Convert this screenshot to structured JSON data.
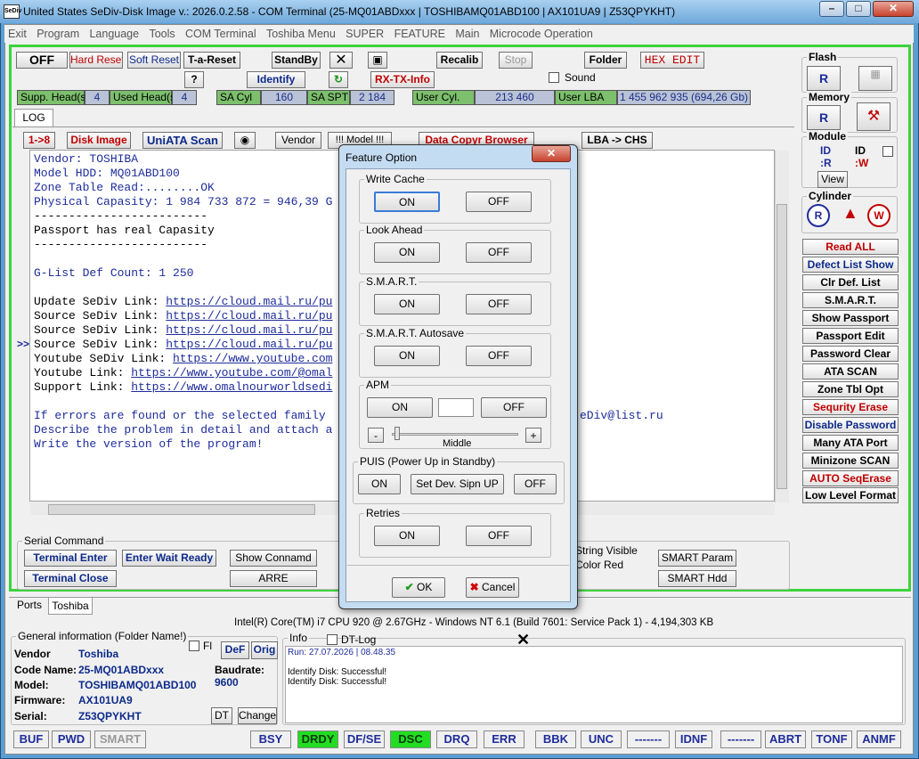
{
  "window": {
    "title": "United States  SeDiv-Disk Image v.: 2026.0.2.58 - COM Terminal  (25-MQ01ABDxxx | TOSHIBAMQ01ABD100 | AX101UA9 | Z53QPYKHT)",
    "icon_text": "SeDiv"
  },
  "menu": [
    "Exit",
    "Program",
    "Language",
    "Tools",
    "COM Terminal",
    "Toshiba Menu",
    "SUPER",
    "FEATURE",
    "Main",
    "Microcode Operation"
  ],
  "toolbar": {
    "off": "OFF",
    "hard_reset": "Hard Reset",
    "soft_reset": "Soft Reset",
    "t_a_reset": "T-a-Reset",
    "standby": "StandBy",
    "recalib": "Recalib",
    "stop": "Stop",
    "folder": "Folder",
    "hex_edit": "HEX EDIT",
    "question": "?",
    "identify": "Identify",
    "rx_tx_info": "RX-TX-Info",
    "sound": "Sound"
  },
  "fields": {
    "supp_heads_label": "Supp. Head(s)",
    "supp_heads": "4",
    "used_heads_label": "Used Head(s)",
    "used_heads": "4",
    "sa_cyl_label": "SA Cyl",
    "sa_cyl": "160",
    "sa_spt_label": "SA SPT",
    "sa_spt": "2 184",
    "user_cyl_label": "User Cyl.",
    "user_cyl": "213 460",
    "user_lba_label": "User LBA",
    "user_lba": "1 455 962 935  (694,26 Gb)"
  },
  "tabs": {
    "log": "LOG",
    "ports": "Ports",
    "toshiba": "Toshiba"
  },
  "log_toolbar": {
    "one_to_eight": "1->8",
    "disk_image": "Disk Image",
    "uniata_scan": "UniATA Scan",
    "vendor": "Vendor",
    "model": "!!! Model !!!",
    "data_copy": "Data Copyr Browser",
    "lba_chs": "LBA -> CHS"
  },
  "log": {
    "lines": [
      "Vendor: TOSHIBA",
      "Model HDD: MQ01ABD100",
      "Zone Table Read:........OK",
      "Physical Capasity: 1 984 733 872 = 946,39 G",
      "-------------------------",
      "Passport has real Capasity",
      "-------------------------",
      "",
      "G-List Def Count: 1 250",
      ""
    ],
    "links": [
      {
        "label": "Update SeDiv Link: ",
        "url": "https://cloud.mail.ru/pu"
      },
      {
        "label": "Source SeDiv Link: ",
        "url": "https://cloud.mail.ru/pu"
      },
      {
        "label": "Source SeDiv Link: ",
        "url": "https://cloud.mail.ru/pu"
      },
      {
        "label": "Source SeDiv Link: ",
        "url": "https://cloud.mail.ru/pu"
      },
      {
        "label": "Youtube SeDiv Link: ",
        "url": "https://www.youtube.com"
      },
      {
        "label": "Youtube Link: ",
        "url": "https://www.youtube.com/@omal"
      },
      {
        "label": "Support Link: ",
        "url": "https://www.omalnourworldsedi"
      }
    ],
    "footer": [
      "If errors are found or the selected family ",
      "Describe the problem in detail and attach a",
      "Write the version of the program!"
    ],
    "footer_tail": "eDiv@list.ru"
  },
  "serial": {
    "title": "Serial Command",
    "terminal_enter": "Terminal Enter",
    "enter_wait_ready": "Enter Wait Ready",
    "show_command": "Show Connamd",
    "terminal_close": "Terminal Close",
    "arre": "ARRE",
    "string_visible": "String Visible",
    "color_red": "Color Red",
    "smart_param": "SMART Param",
    "smart_hdd": "SMART Hdd"
  },
  "sidebar": {
    "flash": "Flash",
    "memory": "Memory",
    "module": "Module",
    "id": "ID",
    "view": "View",
    "cylinder": "Cylinder",
    "items": [
      {
        "label": "Read ALL",
        "style": "red"
      },
      {
        "label": "Defect List Show",
        "style": "blue"
      },
      {
        "label": "Clr Def. List",
        "style": ""
      },
      {
        "label": "S.M.A.R.T.",
        "style": ""
      },
      {
        "label": "Show Passport",
        "style": ""
      },
      {
        "label": "Passport Edit",
        "style": ""
      },
      {
        "label": "Password Clear",
        "style": ""
      },
      {
        "label": "ATA SCAN",
        "style": ""
      },
      {
        "label": "Zone Tbl Opt",
        "style": ""
      },
      {
        "label": "Sequrity Erase",
        "style": "red"
      },
      {
        "label": "Disable Password",
        "style": "blue"
      },
      {
        "label": "Many ATA Port",
        "style": ""
      },
      {
        "label": "Minizone SCAN",
        "style": ""
      },
      {
        "label": "AUTO SeqErase",
        "style": "red"
      },
      {
        "label": "Low Level Format",
        "style": ""
      }
    ]
  },
  "dialog": {
    "title": "Feature Option",
    "write_cache": "Write Cache",
    "look_ahead": "Look Ahead",
    "smart": "S.M.A.R.T.",
    "smart_autosave": "S.M.A.R.T. Autosave",
    "apm": "APM",
    "puis": "PUIS (Power Up in Standby)",
    "retries": "Retries",
    "on": "ON",
    "off": "OFF",
    "middle": "Middle",
    "minus": "-",
    "plus": "+",
    "set_dev_spin_up": "Set Dev. Sipn UP",
    "ok": "OK",
    "cancel": "Cancel"
  },
  "cpu_info": "Intel(R) Core(TM) i7 CPU 920  @ 2.67GHz - Windows NT 6.1 (Build 7601: Service Pack 1) -  4,194,303 KB",
  "general_info": {
    "title": "General information (Folder Name!)",
    "fl": "Fl",
    "def": "DeF",
    "orig": "Orig",
    "vendor_label": "Vendor",
    "vendor": "Toshiba",
    "code_label": "Code Name:",
    "code": "25-MQ01ABDxxx",
    "model_label": "Model:",
    "model": "TOSHIBAMQ01ABD100",
    "firmware_label": "Firmware:",
    "firmware": "AX101UA9",
    "serial_label": "Serial:",
    "serial": "Z53QPYKHT",
    "baud_label": "Baudrate:",
    "baud": "9600",
    "dt": "DT",
    "change": "Change"
  },
  "info": {
    "title": "Info",
    "dt_log": "DT-Log",
    "lines": [
      "Run: 27.07.2026 | 08.48.35",
      "",
      "Identify Disk: Successful!",
      "Identify Disk: Successful!"
    ]
  },
  "statusbar": [
    {
      "label": "BUF",
      "state": ""
    },
    {
      "label": "PWD",
      "state": ""
    },
    {
      "label": "SMART",
      "state": "dis"
    },
    {
      "label": "BSY",
      "state": ""
    },
    {
      "label": "DRDY",
      "state": "on"
    },
    {
      "label": "DF/SE",
      "state": ""
    },
    {
      "label": "DSC",
      "state": "on"
    },
    {
      "label": "DRQ",
      "state": ""
    },
    {
      "label": "ERR",
      "state": ""
    },
    {
      "label": "BBK",
      "state": ""
    },
    {
      "label": "UNC",
      "state": ""
    },
    {
      "label": "-------",
      "state": ""
    },
    {
      "label": "IDNF",
      "state": ""
    },
    {
      "label": "-------",
      "state": ""
    },
    {
      "label": "ABRT",
      "state": ""
    },
    {
      "label": "TONF",
      "state": ""
    },
    {
      "label": "ANMF",
      "state": ""
    }
  ]
}
